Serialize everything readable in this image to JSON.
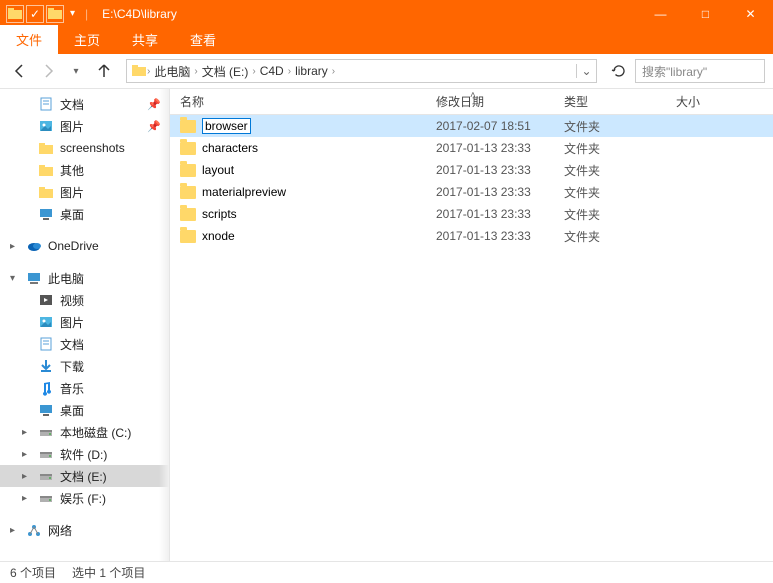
{
  "window": {
    "title": "E:\\C4D\\library",
    "controls": {
      "min": "—",
      "max": "□",
      "close": "✕"
    }
  },
  "ribbon": {
    "file": "文件",
    "home": "主页",
    "share": "共享",
    "view": "查看"
  },
  "nav": {
    "back": "←",
    "forward": "→",
    "up": "↑",
    "refresh": "↻"
  },
  "breadcrumb": {
    "items": [
      "此电脑",
      "文档 (E:)",
      "C4D",
      "library"
    ]
  },
  "search": {
    "placeholder": "搜索\"library\""
  },
  "columns": {
    "name": "名称",
    "date": "修改日期",
    "type": "类型",
    "size": "大小"
  },
  "tree": [
    {
      "label": "文档",
      "icon": "doc",
      "level": 1,
      "pin": true
    },
    {
      "label": "图片",
      "icon": "pic",
      "level": 1,
      "pin": true
    },
    {
      "label": "screenshots",
      "icon": "folder",
      "level": 1
    },
    {
      "label": "其他",
      "icon": "folder",
      "level": 1
    },
    {
      "label": "图片",
      "icon": "folder",
      "level": 1
    },
    {
      "label": "桌面",
      "icon": "desktop",
      "level": 1
    },
    {
      "spacer": true
    },
    {
      "label": "OneDrive",
      "icon": "onedrive",
      "level": 0,
      "exp": "▸"
    },
    {
      "spacer": true
    },
    {
      "label": "此电脑",
      "icon": "pc",
      "level": 0,
      "exp": "▾"
    },
    {
      "label": "视频",
      "icon": "video",
      "level": 1
    },
    {
      "label": "图片",
      "icon": "pic",
      "level": 1
    },
    {
      "label": "文档",
      "icon": "doc",
      "level": 1
    },
    {
      "label": "下载",
      "icon": "download",
      "level": 1
    },
    {
      "label": "音乐",
      "icon": "music",
      "level": 1
    },
    {
      "label": "桌面",
      "icon": "desktop",
      "level": 1
    },
    {
      "label": "本地磁盘 (C:)",
      "icon": "drive",
      "level": 1,
      "exp": "▸"
    },
    {
      "label": "软件 (D:)",
      "icon": "drive",
      "level": 1,
      "exp": "▸"
    },
    {
      "label": "文档 (E:)",
      "icon": "drive",
      "level": 1,
      "exp": "▸",
      "selected": true
    },
    {
      "label": "娱乐 (F:)",
      "icon": "drive",
      "level": 1,
      "exp": "▸"
    },
    {
      "spacer": true
    },
    {
      "label": "网络",
      "icon": "network",
      "level": 0,
      "exp": "▸"
    }
  ],
  "files": [
    {
      "name": "browser",
      "date": "2017-02-07 18:51",
      "type": "文件夹",
      "selected": true,
      "editing": true
    },
    {
      "name": "characters",
      "date": "2017-01-13 23:33",
      "type": "文件夹"
    },
    {
      "name": "layout",
      "date": "2017-01-13 23:33",
      "type": "文件夹"
    },
    {
      "name": "materialpreview",
      "date": "2017-01-13 23:33",
      "type": "文件夹"
    },
    {
      "name": "scripts",
      "date": "2017-01-13 23:33",
      "type": "文件夹"
    },
    {
      "name": "xnode",
      "date": "2017-01-13 23:33",
      "type": "文件夹"
    }
  ],
  "status": {
    "count": "6 个项目",
    "selected": "选中 1 个项目"
  }
}
